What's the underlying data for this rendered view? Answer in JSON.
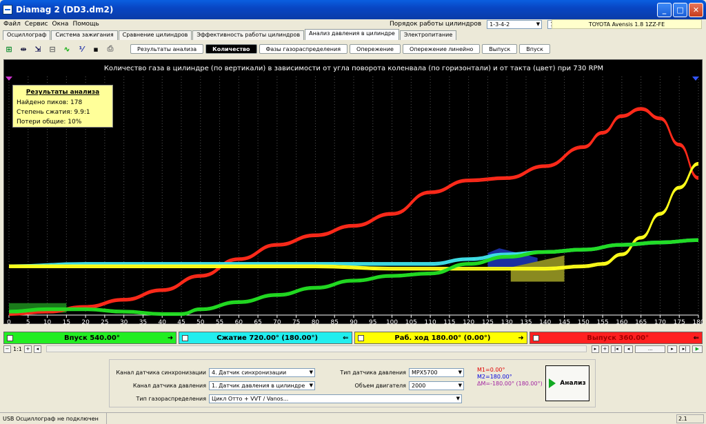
{
  "window": {
    "title": "Diamag 2 (DD3.dm2)"
  },
  "menu": [
    "Файл",
    "Сервис",
    "Окна",
    "Помощь"
  ],
  "cylinder_order": {
    "label": "Порядок работы цилиндров",
    "value": "1-3-4-2",
    "cyl": "1"
  },
  "car": "TOYOTA Avensis 1.8 1ZZ-FE",
  "tabs": [
    "Осциллограф",
    "Система зажигания",
    "Сравнение цилиндров",
    "Эффективность работы цилиндров",
    "Анализ давления в цилиндре",
    "Электропитание"
  ],
  "active_tab": 4,
  "subtabs": [
    "Результаты анализа",
    "Количество",
    "Фазы газораспределения",
    "Опережение",
    "Опережение линейно",
    "Выпуск",
    "Впуск"
  ],
  "active_subtab": 1,
  "toolbar_icons": [
    "auto-scale-icon",
    "x1024-icon",
    "auto-icon",
    "grid-icon",
    "curve-icon",
    "algo-icon",
    "save-icon",
    "print-icon"
  ],
  "toolbar_glyphs": [
    "⊞",
    "⇹",
    "⇲",
    "⊟",
    "∿",
    "⅟",
    "▪",
    "⎙"
  ],
  "plot": {
    "title": "Количество газа в цилиндре (по вертикали) в зависимости от угла поворота коленвала (по горизонтали) и от такта (цвет) при 730 RPM"
  },
  "results": {
    "heading": "Результаты анализа",
    "lines": [
      "Найдено пиков: 178",
      "Степень сжатия: 9.9:1",
      "Потери общие: 10%"
    ]
  },
  "chart_data": {
    "type": "line",
    "title": "Количество газа в цилиндре (по вертикали) в зависимости от угла поворота коленвала (по горизонтали) и от такта (цвет) при 730 RPM",
    "xlabel": "",
    "ylabel": "",
    "xlim": [
      0,
      180
    ],
    "ylim": [
      0,
      100
    ],
    "grid": true,
    "x_ticks": [
      0,
      5,
      10,
      15,
      20,
      25,
      30,
      35,
      40,
      45,
      50,
      55,
      60,
      65,
      70,
      75,
      80,
      85,
      90,
      95,
      100,
      105,
      110,
      115,
      120,
      125,
      130,
      135,
      140,
      145,
      150,
      155,
      160,
      165,
      170,
      175,
      180
    ],
    "series": [
      {
        "color": "#ff2a1a",
        "x": [
          0,
          10,
          20,
          30,
          40,
          50,
          60,
          70,
          80,
          90,
          100,
          110,
          120,
          130,
          140,
          150,
          155,
          160,
          165,
          170,
          175,
          180
        ],
        "y": [
          1,
          2,
          4,
          7,
          11,
          17,
          24,
          30,
          34,
          38,
          43,
          52,
          57,
          58,
          63,
          71,
          77,
          84,
          87,
          83,
          72,
          58
        ]
      },
      {
        "color": "#40e0e8",
        "x": [
          0,
          20,
          40,
          60,
          80,
          100,
          110,
          120,
          130,
          140,
          150,
          160,
          170,
          180
        ],
        "y": [
          21,
          22,
          22,
          22,
          22,
          22,
          22,
          24,
          26,
          27,
          28,
          30,
          31,
          32
        ]
      },
      {
        "color": "#ffff1a",
        "x": [
          0,
          20,
          40,
          60,
          80,
          100,
          120,
          140,
          150,
          155,
          160,
          165,
          170,
          175,
          180
        ],
        "y": [
          21,
          21,
          21,
          21,
          21,
          20,
          20,
          20,
          21,
          22,
          26,
          33,
          43,
          54,
          64
        ]
      },
      {
        "color": "#22dd22",
        "x": [
          0,
          10,
          20,
          30,
          40,
          45,
          50,
          60,
          70,
          80,
          90,
          100,
          110,
          120,
          130,
          140,
          150,
          160,
          170,
          180
        ],
        "y": [
          2,
          3,
          3,
          2,
          1,
          1,
          3,
          6,
          9,
          12,
          15,
          17,
          18,
          22,
          25,
          27,
          28,
          30,
          31,
          32
        ]
      }
    ]
  },
  "phases": [
    {
      "label": "Впуск 540.00°",
      "color": "#22ee22",
      "arrow": "➜"
    },
    {
      "label": "Сжатие 720.00° (180.00°)",
      "color": "#22eeee",
      "arrow": "⇐"
    },
    {
      "label": "Раб. ход 180.00° (0.00°)",
      "color": "#ffff00",
      "arrow": "➜"
    },
    {
      "label": "Выпуск 360.00°",
      "color": "#ff2020",
      "arrow": "⇐"
    }
  ],
  "zoom": "1:1",
  "panel": {
    "sync_label": "Канал датчика синхронизации",
    "sync_value": "4. Датчик синхронизации",
    "press_label": "Канал датчика давления",
    "press_value": "1. Датчик давления в цилиндре",
    "gas_label": "Тип газораспределения",
    "gas_value": "Цикл Отто + VVT / Vanos...",
    "sensor_label": "Тип датчика давления",
    "sensor_value": "MPX5700",
    "volume_label": "Объем двигателя",
    "volume_value": "2000",
    "m1": "M1=0.00°",
    "m2": "M2=180.00°",
    "dm": "ΔM=-180.00° (180.00°)",
    "analyze": "Анализ"
  },
  "status": {
    "left": "USB Осциллограф не подключен",
    "right": "2.1"
  }
}
